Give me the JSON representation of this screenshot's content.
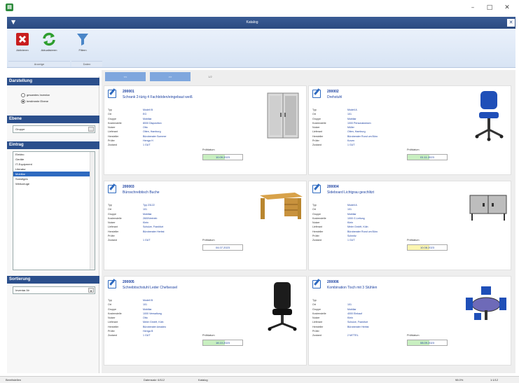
{
  "window": {
    "app_icon_glyph": "▤",
    "minimize": "–",
    "maximize": "□",
    "close": "✕"
  },
  "ribbon": {
    "title": "Katalog",
    "collapse_glyph": "▼",
    "close_glyph": "✕",
    "buttons": {
      "delete": "Aktivieren",
      "refresh": "Aktualisieren",
      "filter": "Filtern"
    },
    "groups": {
      "anzeige": "Anzeige",
      "daten": "Daten"
    }
  },
  "sidebar": {
    "darstellung": {
      "title": "Darstellung",
      "opt1": "gesamtes Inventar",
      "opt2": "bestimmte Ebene"
    },
    "ebene": {
      "title": "Ebene",
      "value": "Gruppe",
      "btn": "…"
    },
    "eintrag": {
      "title": "Eintrag",
      "items": [
        "Elektro",
        "Geräte",
        "IT-Equipment",
        "Literatur",
        "Mobiliar",
        "Sonstiges",
        "Werkzeuge"
      ]
    },
    "sortierung": {
      "title": "Sortierung",
      "value": "Inventar-Nr",
      "btn": "▾"
    }
  },
  "pagination": {
    "btn1": "<<",
    "btn2": ">>",
    "info": "1/2"
  },
  "labels": {
    "typ": "Typ",
    "ort": "Ort",
    "gruppe": "Gruppe",
    "kostenstelle": "Kostenstelle",
    "nutzer": "Nutzer",
    "lieferant": "Lieferant",
    "hersteller": "Hersteller",
    "pruefer": "Prüfer",
    "zustand": "Zustand",
    "pruefdatum": "Prüfdatum"
  },
  "cards": [
    {
      "num": "200001",
      "title": "Schrank 2-türig 4 Fachböden/eingebaut weiß",
      "typ": "Modell B",
      "ort": "EG",
      "gruppe": "Mobiliar",
      "kostenstelle": "8000 Disposition",
      "nutzer": "Otto",
      "lieferant": "Otten, Hamburg",
      "hersteller": "Büroberater Sommer",
      "pruefer": "Herrga H",
      "zustand": "1 GUT",
      "pruefdatum": "10.09.2023"
    },
    {
      "num": "200002",
      "title": "Drehstuhl",
      "typ": "Modell A",
      "ort": "101",
      "gruppe": "Mobiliar",
      "kostenstelle": "1000 Personalwesen",
      "nutzer": "Müller",
      "lieferant": "Otten, Hamburg",
      "hersteller": "Büroberater Rund um Büro",
      "pruefer": "Koven",
      "zustand": "1 GUT",
      "pruefdatum": "01.11.2023"
    },
    {
      "num": "200003",
      "title": "Büroschreibtisch Buche",
      "typ": "Typ 23122",
      "ort": "101",
      "gruppe": "Mobiliar",
      "kostenstelle": "2600Vertrieb",
      "nutzer": "Klein",
      "lieferant": "Schulze, Frankfurt",
      "hersteller": "Büroberater Herbst",
      "pruefer": "",
      "zustand": "1 GUT",
      "pruefdatum": "04.07.2023"
    },
    {
      "num": "200004",
      "title": "Sideboard Lichtgrau geschlitzt",
      "typ": "Modell A",
      "ort": "101",
      "gruppe": "Mobiliar",
      "kostenstelle": "1000 G.Leitung",
      "nutzer": "Klein",
      "lieferant": "Meier GmbH, Köln",
      "hersteller": "Büroberater Rund um Büro",
      "pruefer": "Schmitz",
      "zustand": "1 GUT",
      "pruefdatum": "10.08.2023"
    },
    {
      "num": "200005",
      "title": "Schreibtischstuhl Leder Chefsessel",
      "typ": "Modell B",
      "ort": "101",
      "gruppe": "Mobiliar",
      "kostenstelle": "1000 Verwaltung",
      "nutzer": "Otto",
      "lieferant": "Meier GmbH, Köln",
      "hersteller": "Büroberater Amadeo",
      "pruefer": "Herrga B",
      "zustand": "1 GUT",
      "pruefdatum": "18.10.2023"
    },
    {
      "num": "200006",
      "title": "Kombination Tisch mit 3 Stühlen",
      "typ": "",
      "ort": "101",
      "gruppe": "Mobiliar",
      "kostenstelle": "4000 Einkauf",
      "nutzer": "Klein",
      "lieferant": "Schulze, Frankfurt",
      "hersteller": "Büroberater Herbst",
      "pruefer": "",
      "zustand": "2 MITTEL",
      "pruefdatum": "08.09.2023"
    }
  ],
  "statusbar": {
    "left": "Bereitstellen",
    "mid1": "Datensatz: 6/112",
    "mid2": "Katalog",
    "right1": "98.0%",
    "right2": "1:1/12"
  },
  "colors": {
    "accent": "#2b4f8c",
    "link": "#1a3fa0",
    "pruef_green": "#c8efc0",
    "pruef_yellow": "#fbf5b0"
  }
}
